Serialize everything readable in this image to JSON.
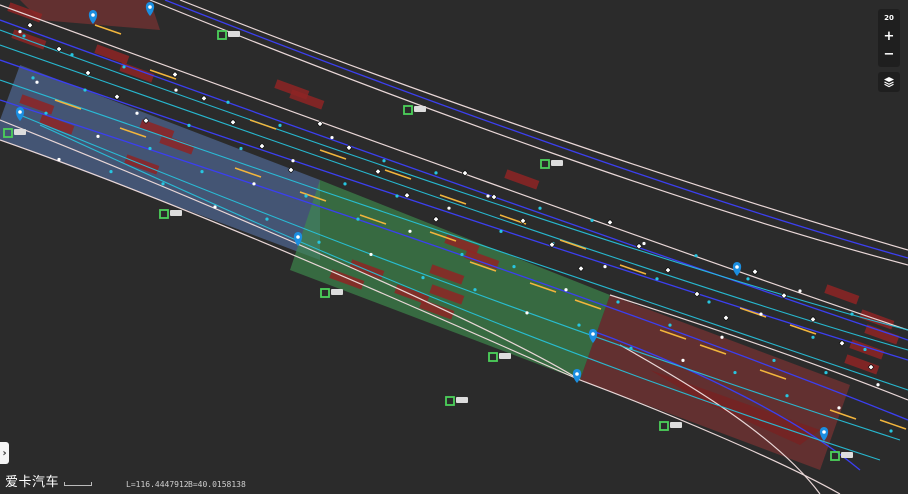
{
  "map": {
    "zoom_level": "20",
    "zoom_in_label": "+",
    "zoom_out_label": "−",
    "layers_icon": "layers-icon",
    "sidebar_toggle_label": "›",
    "watermark": "爱卡汽车",
    "coords": {
      "lon": "L=116.4447912",
      "lat": "B=40.0158138"
    },
    "road_sign_count": 9,
    "poi_marker_count": 8,
    "colors": {
      "background": "#2b2b2b",
      "road_boundary": "#e9d7d7",
      "lane_divider": "#3b3ff0",
      "lane_center": "#27c6e0",
      "stop_segment": "#f2b53c",
      "section_blue": "#5a78b0",
      "section_green": "#3d8c4d",
      "section_red": "#9a3535",
      "obstacle": "#8e2525",
      "poi": "#1b8ee0",
      "sign": "#4cd15a"
    }
  }
}
